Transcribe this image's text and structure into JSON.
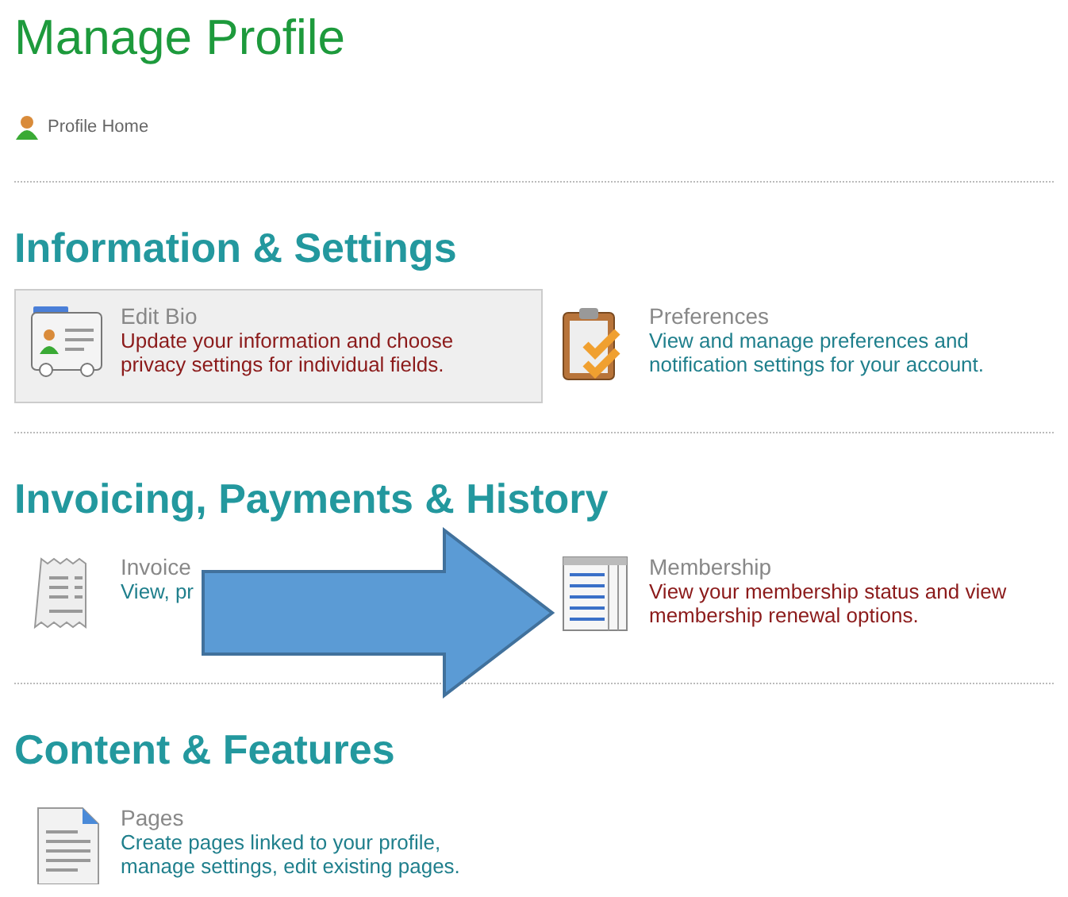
{
  "page_title": "Manage Profile",
  "breadcrumb": {
    "label": "Profile Home"
  },
  "sections": [
    {
      "heading": "Information & Settings",
      "items": [
        {
          "kind": "card",
          "title": "Edit Bio",
          "description": "Update your information and choose privacy settings for individual fields.",
          "selected": true,
          "color": "#8b1a1a"
        },
        {
          "kind": "clipboard",
          "title": "Preferences",
          "description": "View and manage preferences and notification settings for your account.",
          "selected": false,
          "color": "#1f7f8c"
        }
      ]
    },
    {
      "heading": "Invoicing, Payments & History",
      "items": [
        {
          "kind": "receipt",
          "title": "Invoice",
          "description": "View, pr",
          "selected": false,
          "color": "#1f7f8c"
        },
        {
          "kind": "table",
          "title": "Membership",
          "description": "View your membership status and view membership renewal options.",
          "selected": false,
          "color": "#8b1a1a"
        }
      ]
    },
    {
      "heading": "Content & Features",
      "items": [
        {
          "kind": "document",
          "title": "Pages",
          "description": "Create pages linked to your profile, manage settings, edit existing pages.",
          "selected": false,
          "color": "#1f7f8c"
        }
      ]
    }
  ]
}
